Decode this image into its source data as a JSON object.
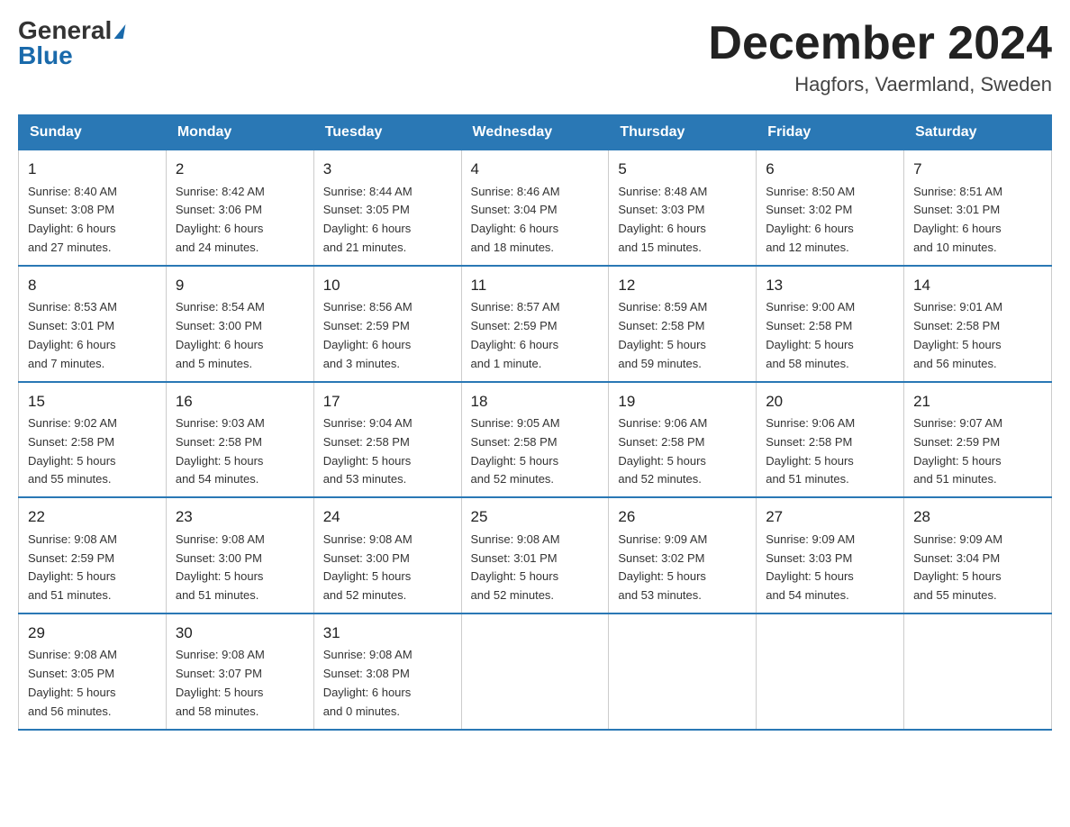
{
  "logo": {
    "general": "General",
    "blue": "Blue"
  },
  "title": "December 2024",
  "location": "Hagfors, Vaermland, Sweden",
  "days_of_week": [
    "Sunday",
    "Monday",
    "Tuesday",
    "Wednesday",
    "Thursday",
    "Friday",
    "Saturday"
  ],
  "weeks": [
    [
      {
        "day": "1",
        "sunrise": "8:40 AM",
        "sunset": "3:08 PM",
        "daylight": "6 hours and 27 minutes."
      },
      {
        "day": "2",
        "sunrise": "8:42 AM",
        "sunset": "3:06 PM",
        "daylight": "6 hours and 24 minutes."
      },
      {
        "day": "3",
        "sunrise": "8:44 AM",
        "sunset": "3:05 PM",
        "daylight": "6 hours and 21 minutes."
      },
      {
        "day": "4",
        "sunrise": "8:46 AM",
        "sunset": "3:04 PM",
        "daylight": "6 hours and 18 minutes."
      },
      {
        "day": "5",
        "sunrise": "8:48 AM",
        "sunset": "3:03 PM",
        "daylight": "6 hours and 15 minutes."
      },
      {
        "day": "6",
        "sunrise": "8:50 AM",
        "sunset": "3:02 PM",
        "daylight": "6 hours and 12 minutes."
      },
      {
        "day": "7",
        "sunrise": "8:51 AM",
        "sunset": "3:01 PM",
        "daylight": "6 hours and 10 minutes."
      }
    ],
    [
      {
        "day": "8",
        "sunrise": "8:53 AM",
        "sunset": "3:01 PM",
        "daylight": "6 hours and 7 minutes."
      },
      {
        "day": "9",
        "sunrise": "8:54 AM",
        "sunset": "3:00 PM",
        "daylight": "6 hours and 5 minutes."
      },
      {
        "day": "10",
        "sunrise": "8:56 AM",
        "sunset": "2:59 PM",
        "daylight": "6 hours and 3 minutes."
      },
      {
        "day": "11",
        "sunrise": "8:57 AM",
        "sunset": "2:59 PM",
        "daylight": "6 hours and 1 minute."
      },
      {
        "day": "12",
        "sunrise": "8:59 AM",
        "sunset": "2:58 PM",
        "daylight": "5 hours and 59 minutes."
      },
      {
        "day": "13",
        "sunrise": "9:00 AM",
        "sunset": "2:58 PM",
        "daylight": "5 hours and 58 minutes."
      },
      {
        "day": "14",
        "sunrise": "9:01 AM",
        "sunset": "2:58 PM",
        "daylight": "5 hours and 56 minutes."
      }
    ],
    [
      {
        "day": "15",
        "sunrise": "9:02 AM",
        "sunset": "2:58 PM",
        "daylight": "5 hours and 55 minutes."
      },
      {
        "day": "16",
        "sunrise": "9:03 AM",
        "sunset": "2:58 PM",
        "daylight": "5 hours and 54 minutes."
      },
      {
        "day": "17",
        "sunrise": "9:04 AM",
        "sunset": "2:58 PM",
        "daylight": "5 hours and 53 minutes."
      },
      {
        "day": "18",
        "sunrise": "9:05 AM",
        "sunset": "2:58 PM",
        "daylight": "5 hours and 52 minutes."
      },
      {
        "day": "19",
        "sunrise": "9:06 AM",
        "sunset": "2:58 PM",
        "daylight": "5 hours and 52 minutes."
      },
      {
        "day": "20",
        "sunrise": "9:06 AM",
        "sunset": "2:58 PM",
        "daylight": "5 hours and 51 minutes."
      },
      {
        "day": "21",
        "sunrise": "9:07 AM",
        "sunset": "2:59 PM",
        "daylight": "5 hours and 51 minutes."
      }
    ],
    [
      {
        "day": "22",
        "sunrise": "9:08 AM",
        "sunset": "2:59 PM",
        "daylight": "5 hours and 51 minutes."
      },
      {
        "day": "23",
        "sunrise": "9:08 AM",
        "sunset": "3:00 PM",
        "daylight": "5 hours and 51 minutes."
      },
      {
        "day": "24",
        "sunrise": "9:08 AM",
        "sunset": "3:00 PM",
        "daylight": "5 hours and 52 minutes."
      },
      {
        "day": "25",
        "sunrise": "9:08 AM",
        "sunset": "3:01 PM",
        "daylight": "5 hours and 52 minutes."
      },
      {
        "day": "26",
        "sunrise": "9:09 AM",
        "sunset": "3:02 PM",
        "daylight": "5 hours and 53 minutes."
      },
      {
        "day": "27",
        "sunrise": "9:09 AM",
        "sunset": "3:03 PM",
        "daylight": "5 hours and 54 minutes."
      },
      {
        "day": "28",
        "sunrise": "9:09 AM",
        "sunset": "3:04 PM",
        "daylight": "5 hours and 55 minutes."
      }
    ],
    [
      {
        "day": "29",
        "sunrise": "9:08 AM",
        "sunset": "3:05 PM",
        "daylight": "5 hours and 56 minutes."
      },
      {
        "day": "30",
        "sunrise": "9:08 AM",
        "sunset": "3:07 PM",
        "daylight": "5 hours and 58 minutes."
      },
      {
        "day": "31",
        "sunrise": "9:08 AM",
        "sunset": "3:08 PM",
        "daylight": "6 hours and 0 minutes."
      },
      null,
      null,
      null,
      null
    ]
  ]
}
